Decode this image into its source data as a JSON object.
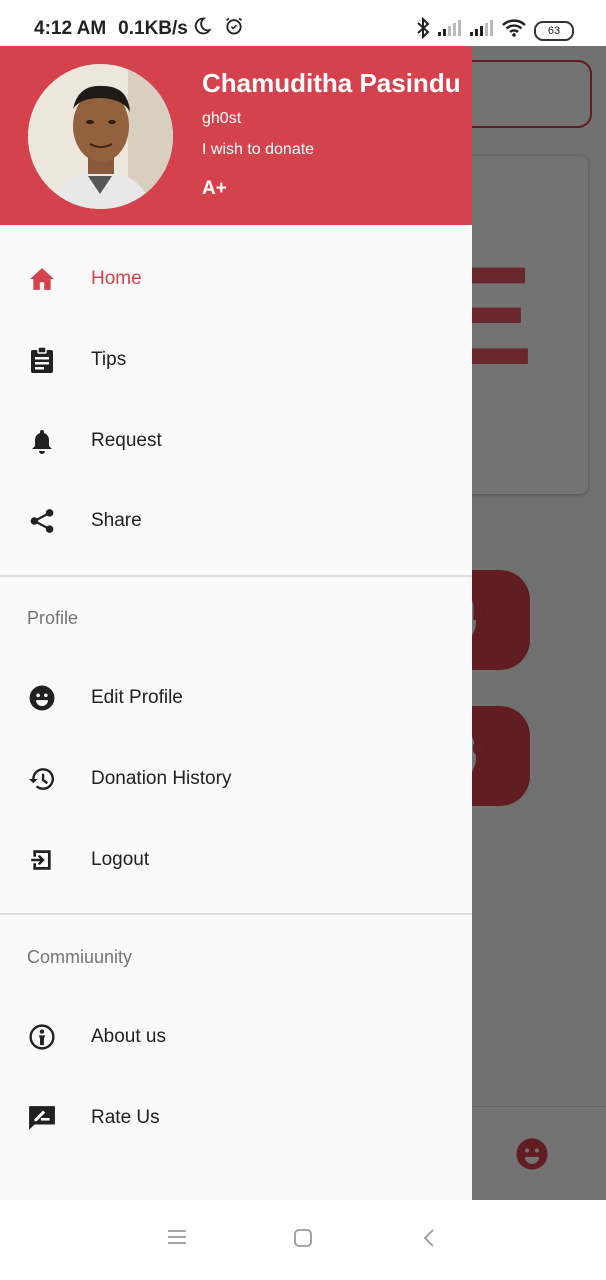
{
  "status_bar": {
    "time": "4:12 AM",
    "speed": "0.1KB/s",
    "battery": "63"
  },
  "drawer": {
    "header": {
      "name": "Chamuditha Pasindu",
      "handle": "gh0st",
      "status": "I wish to donate",
      "blood_type": "A+"
    },
    "main_items": [
      {
        "label": "Home",
        "icon": "home-icon",
        "active": true
      },
      {
        "label": "Tips",
        "icon": "clipboard-icon"
      },
      {
        "label": "Request",
        "icon": "bell-icon"
      },
      {
        "label": "Share",
        "icon": "share-icon"
      }
    ],
    "profile_section": {
      "title": "Profile",
      "items": [
        {
          "label": "Edit Profile",
          "icon": "smiley-icon"
        },
        {
          "label": "Donation History",
          "icon": "history-icon"
        },
        {
          "label": "Logout",
          "icon": "logout-icon"
        }
      ]
    },
    "community_section": {
      "title": "Commiuunity",
      "items": [
        {
          "label": "About us",
          "icon": "info-icon"
        },
        {
          "label": "Rate Us",
          "icon": "rate-review-icon"
        }
      ]
    }
  },
  "background": {
    "blood_type_1": "B",
    "blood_type_2": "O"
  },
  "colors": {
    "primary": "#d4434d",
    "accent_text": "#d4434d"
  }
}
